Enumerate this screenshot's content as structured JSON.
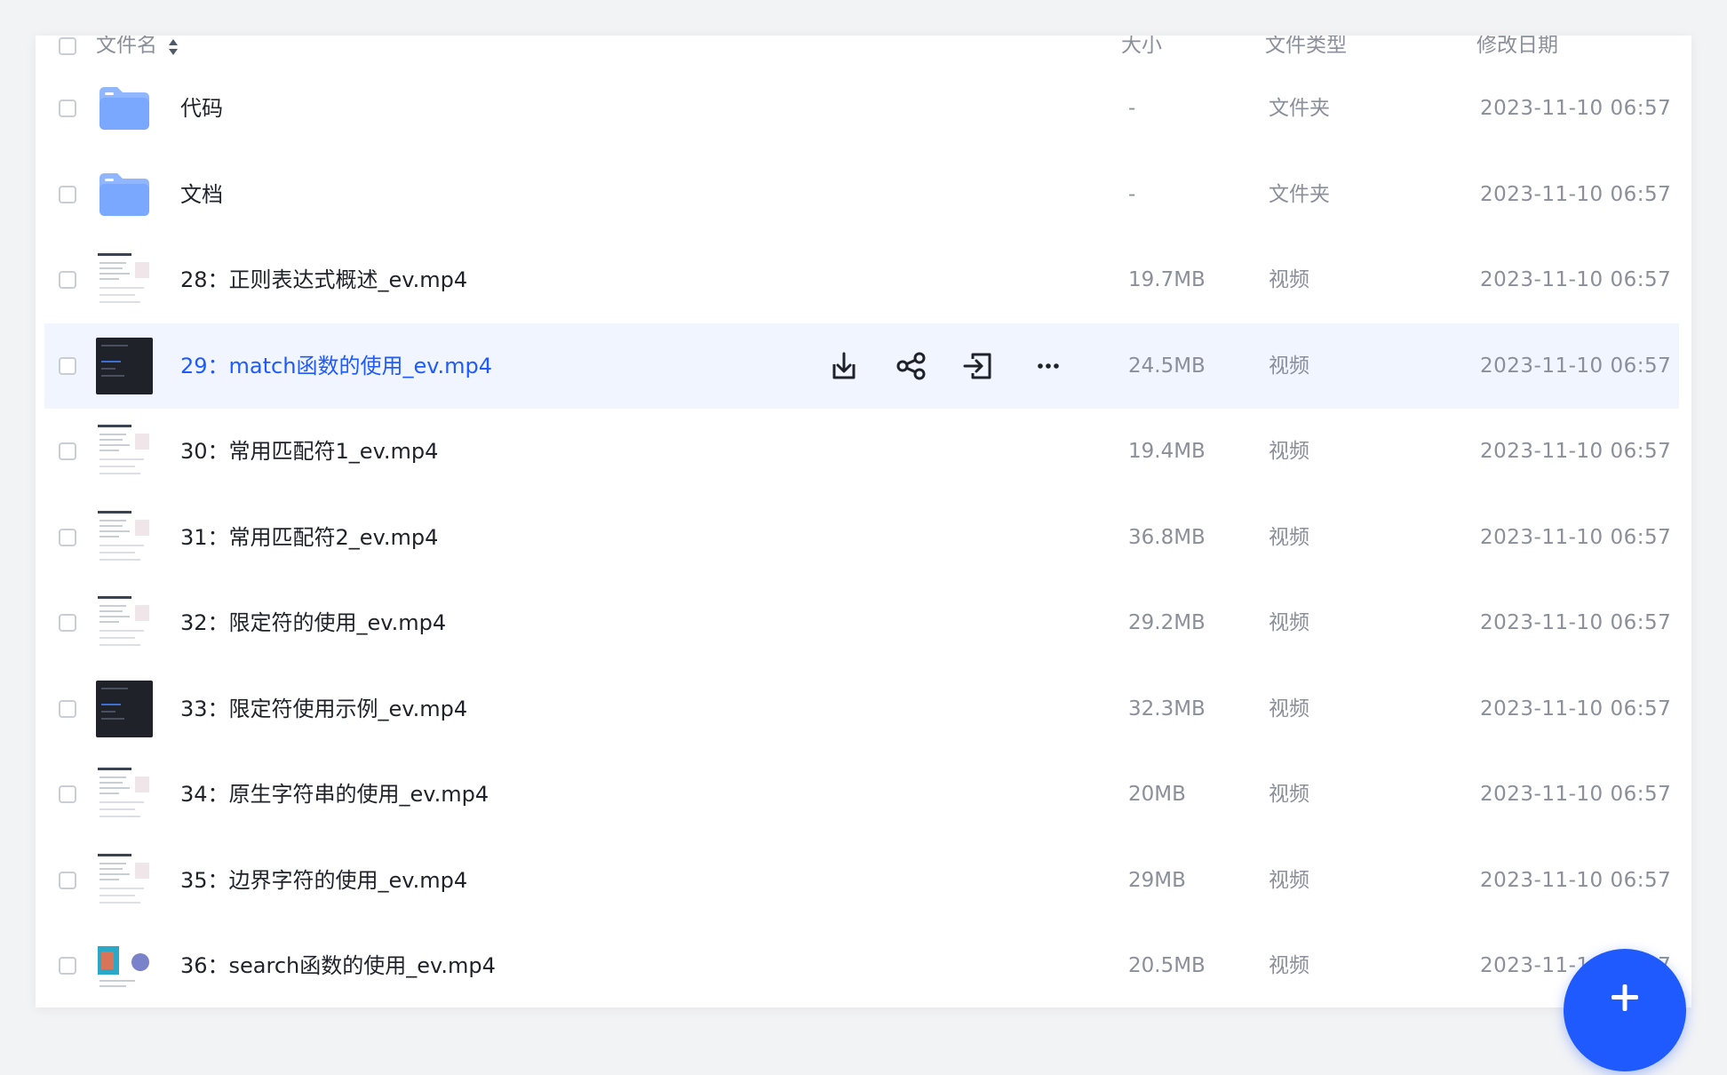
{
  "header": {
    "name_label": "文件名",
    "size_label": "大小",
    "type_label": "文件类型",
    "date_label": "修改日期"
  },
  "files": [
    {
      "name": "代码",
      "size": "-",
      "type": "文件夹",
      "date": "2023-11-10 06:57",
      "kind": "folder"
    },
    {
      "name": "文档",
      "size": "-",
      "type": "文件夹",
      "date": "2023-11-10 06:57",
      "kind": "folder"
    },
    {
      "name": "28：正则表达式概述_ev.mp4",
      "size": "19.7MB",
      "type": "视频",
      "date": "2023-11-10 06:57",
      "kind": "video-light"
    },
    {
      "name": "29：match函数的使用_ev.mp4",
      "size": "24.5MB",
      "type": "视频",
      "date": "2023-11-10 06:57",
      "kind": "video-dark"
    },
    {
      "name": "30：常用匹配符1_ev.mp4",
      "size": "19.4MB",
      "type": "视频",
      "date": "2023-11-10 06:57",
      "kind": "video-light"
    },
    {
      "name": "31：常用匹配符2_ev.mp4",
      "size": "36.8MB",
      "type": "视频",
      "date": "2023-11-10 06:57",
      "kind": "video-light"
    },
    {
      "name": "32：限定符的使用_ev.mp4",
      "size": "29.2MB",
      "type": "视频",
      "date": "2023-11-10 06:57",
      "kind": "video-light"
    },
    {
      "name": "33：限定符使用示例_ev.mp4",
      "size": "32.3MB",
      "type": "视频",
      "date": "2023-11-10 06:57",
      "kind": "video-dark"
    },
    {
      "name": "34：原生字符串的使用_ev.mp4",
      "size": "20MB",
      "type": "视频",
      "date": "2023-11-10 06:57",
      "kind": "video-light"
    },
    {
      "name": "35：边界字符的使用_ev.mp4",
      "size": "29MB",
      "type": "视频",
      "date": "2023-11-10 06:57",
      "kind": "video-light"
    },
    {
      "name": "36：search函数的使用_ev.mp4",
      "size": "20.5MB",
      "type": "视频",
      "date": "2023-11-10 06:57",
      "kind": "video-color"
    }
  ],
  "highlighted_index": 3,
  "row_actions": [
    "download-icon",
    "share-icon",
    "move-icon",
    "more-icon"
  ],
  "fab_icon": "plus-icon",
  "colors": {
    "accent": "#1f5aff",
    "highlight_bg": "#f0f5ff",
    "folder": "#7aa7ff"
  }
}
